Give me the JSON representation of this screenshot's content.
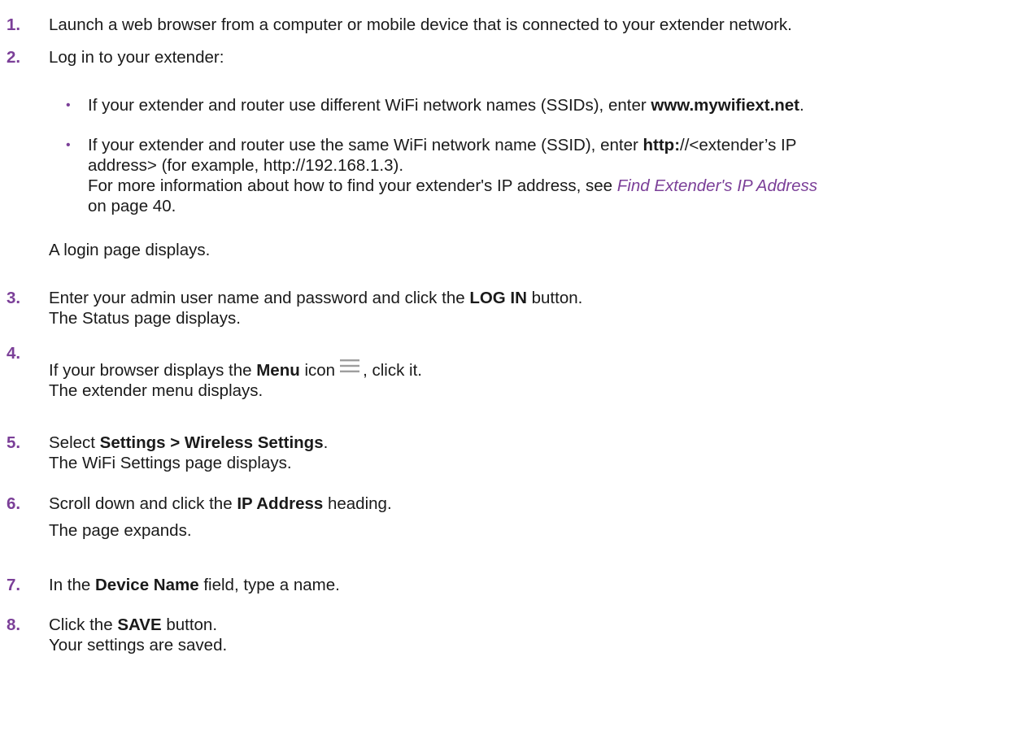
{
  "steps": [
    {
      "num": "1.",
      "text": "Launch a web browser from a computer or mobile device that is connected to your extender network."
    },
    {
      "num": "2.",
      "text": "Log in to your extender:"
    },
    {
      "num": "3.",
      "pre": "Enter your admin user name and password and click the ",
      "bold": "LOG IN",
      "post": " button.",
      "line2": "The Status page displays."
    },
    {
      "num": "4.",
      "pre": "If your browser displays the ",
      "bold": "Menu",
      "mid": " icon",
      "post": ", click it.",
      "line2": "The extender menu displays."
    },
    {
      "num": "5.",
      "pre": "Select ",
      "bold": "Settings > Wireless Settings",
      "post": ".",
      "line2": "The WiFi Settings page displays."
    },
    {
      "num": "6.",
      "pre": "Scroll down and click the ",
      "bold": "IP Address",
      "post": " heading.",
      "line2": "The page expands."
    },
    {
      "num": "7.",
      "pre": "In the ",
      "bold": "Device Name",
      "post": " field, type a name."
    },
    {
      "num": "8.",
      "pre": "Click the ",
      "bold": "SAVE",
      "post": " button.",
      "line2": "Your settings are saved."
    }
  ],
  "bullets": [
    {
      "pre": "If your extender and router use different WiFi network names (SSIDs), enter ",
      "bold": "www.mywifiext.net",
      "post": "."
    },
    {
      "pre": "If your extender and router use the same WiFi network name (SSID), enter ",
      "bold": "http:",
      "post": "//<extender’s IP",
      "line2": "address> (for example, http://192.168.1.3).",
      "line3": "For more information about how to find your extender's IP address, see ",
      "link": "Find Extender's IP Address",
      "line4": "on page 40."
    }
  ],
  "bullet_glyph": "•",
  "after_bullets": "A login page displays.",
  "colors": {
    "accent": "#7b3f98",
    "text": "#1a1a1a",
    "icon": "#9e9e9e"
  },
  "icons": {
    "menu": "menu-icon"
  }
}
